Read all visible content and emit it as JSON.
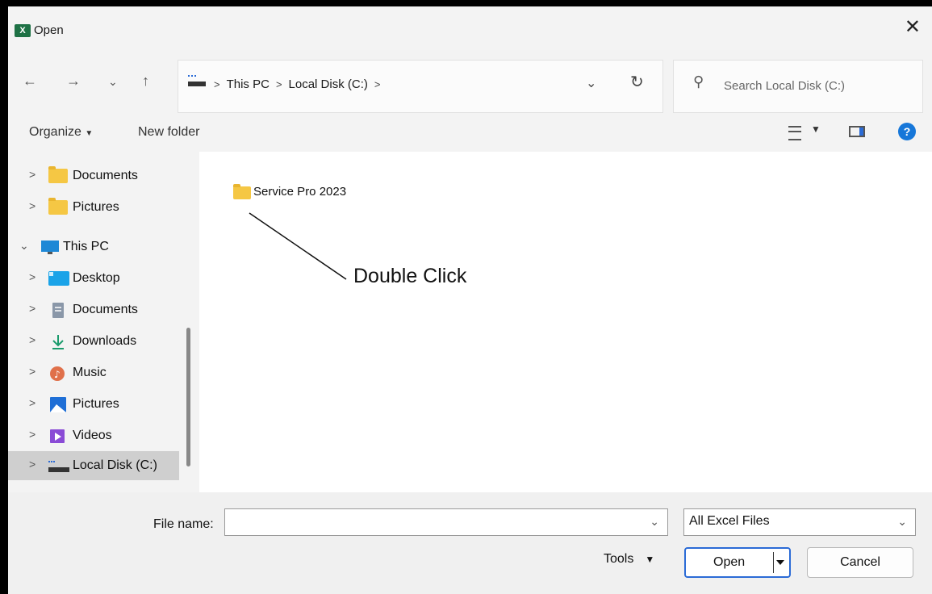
{
  "window": {
    "title": "Open",
    "app_icon": "excel-icon"
  },
  "address_bar": {
    "crumbs": [
      "This PC",
      "Local Disk (C:)"
    ]
  },
  "search": {
    "placeholder": "Search Local Disk (C:)"
  },
  "toolbar": {
    "organize": "Organize",
    "new_folder": "New folder"
  },
  "sidebar": {
    "items": [
      {
        "label": "Documents",
        "icon": "folder-icon"
      },
      {
        "label": "Pictures",
        "icon": "folder-icon"
      },
      {
        "label": "This PC",
        "icon": "computer-icon"
      },
      {
        "label": "Desktop",
        "icon": "desktop-icon"
      },
      {
        "label": "Documents",
        "icon": "documents-icon"
      },
      {
        "label": "Downloads",
        "icon": "download-icon"
      },
      {
        "label": "Music",
        "icon": "music-icon"
      },
      {
        "label": "Pictures",
        "icon": "pictures-icon"
      },
      {
        "label": "Videos",
        "icon": "videos-icon"
      },
      {
        "label": "Local Disk (C:)",
        "icon": "drive-icon"
      }
    ],
    "selected": "Local Disk (C:)"
  },
  "content": {
    "items": [
      {
        "label": "Service Pro 2023",
        "icon": "folder-icon"
      }
    ],
    "annotation": "Double Click"
  },
  "footer": {
    "file_name_label": "File name:",
    "file_name_value": "",
    "file_type": "All Excel Files",
    "tools": "Tools",
    "open": "Open",
    "cancel": "Cancel"
  },
  "colors": {
    "accent": "#2b6bd6",
    "excel": "#1e7145",
    "folder": "#f5c744"
  }
}
